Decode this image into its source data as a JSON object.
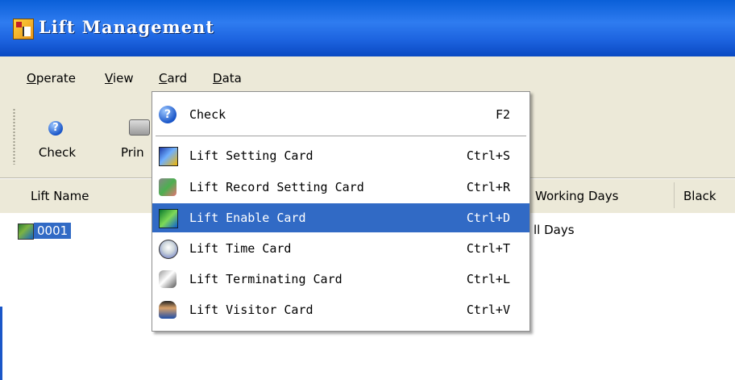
{
  "window": {
    "title": "Lift Management"
  },
  "menubar": {
    "items": [
      {
        "label": "Operate",
        "mnemonic": "O"
      },
      {
        "label": "View",
        "mnemonic": "V"
      },
      {
        "label": "Card",
        "mnemonic": "C"
      },
      {
        "label": "Data",
        "mnemonic": "D"
      }
    ]
  },
  "toolbar": {
    "buttons": [
      {
        "label": "Check",
        "icon": "help-icon"
      },
      {
        "label": "Prin",
        "icon": "printer-icon"
      }
    ]
  },
  "list": {
    "columns": [
      "Lift Name",
      "Working Days",
      "Black"
    ],
    "rows": [
      {
        "name": "0001",
        "working_days": "ll Days"
      }
    ]
  },
  "card_menu": {
    "items": [
      {
        "label": "Check",
        "shortcut": "F2",
        "icon": "help-icon"
      },
      {
        "label": "Lift Setting Card",
        "shortcut": "Ctrl+S",
        "icon": "setting-card-icon"
      },
      {
        "label": "Lift Record Setting Card",
        "shortcut": "Ctrl+R",
        "icon": "record-setting-icon"
      },
      {
        "label": "Lift Enable Card",
        "shortcut": "Ctrl+D",
        "icon": "enable-card-icon",
        "highlighted": true
      },
      {
        "label": "Lift Time Card",
        "shortcut": "Ctrl+T",
        "icon": "time-card-icon"
      },
      {
        "label": "Lift Terminating Card",
        "shortcut": "Ctrl+L",
        "icon": "terminating-card-icon"
      },
      {
        "label": "Lift Visitor Card",
        "shortcut": "Ctrl+V",
        "icon": "visitor-card-icon"
      }
    ]
  },
  "colors": {
    "title_bar": "#1d64e0",
    "menu_highlight": "#316ac5",
    "chrome": "#ece9d8"
  }
}
